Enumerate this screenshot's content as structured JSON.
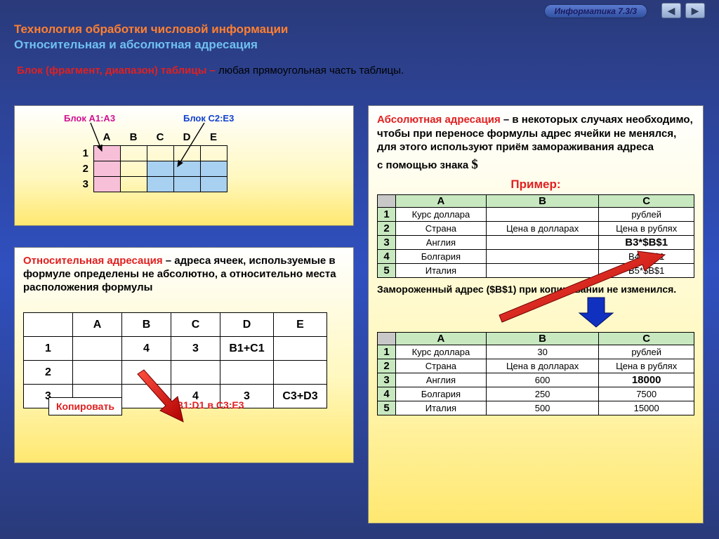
{
  "badge": "Информатика  7.3/3",
  "header": {
    "line1": "Технология обработки числовой информации",
    "line2": "Относительная и абсолютная адресация"
  },
  "definition": {
    "term": "Блок (фрагмент, диапазон) таблицы – ",
    "rest": "любая прямоугольная часть таблицы."
  },
  "topleft": {
    "label_a1": "Блок A1:A3",
    "label_c2": "Блок C2:E3",
    "cols": [
      "A",
      "B",
      "C",
      "D",
      "E"
    ],
    "rows": [
      "1",
      "2",
      "3"
    ]
  },
  "bottomleft": {
    "term": "Относительная адресация",
    "rest": " – адреса ячеек, используемые в формуле определены не абсолютно, а относительно места расположения формулы",
    "cols": [
      "A",
      "B",
      "C",
      "D",
      "E"
    ],
    "rows": [
      "1",
      "2",
      "3"
    ],
    "cells": {
      "b1": "4",
      "c1": "3",
      "d1": "B1+C1",
      "copy_label": "Копировать",
      "copy_ref": "B1:D1 в C3:E3",
      "c3": "4",
      "d3": "3",
      "e3": "C3+D3"
    }
  },
  "right": {
    "term": "Абсолютная адресация",
    "rest": " – в некоторых случаях необходимо, чтобы при переносе формулы адрес ячейки не менялся, для этого используют приём замораживания адреса",
    "dollar_prefix": "с помощью знака ",
    "dollar": "$",
    "primer": "Пример:",
    "cols": [
      "A",
      "B",
      "C"
    ],
    "rows": [
      "1",
      "2",
      "3",
      "4",
      "5"
    ],
    "table1": {
      "r1": {
        "a": "Курс доллара",
        "b": "",
        "c": "рублей"
      },
      "r2": {
        "a": "Страна",
        "b": "Цена в долларах",
        "c": "Цена в рублях"
      },
      "r3": {
        "a": "Англия",
        "b": "",
        "c": "B3*$B$1"
      },
      "r4": {
        "a": "Болгария",
        "b": "",
        "c": "B4*$B$1"
      },
      "r5": {
        "a": "Италия",
        "b": "",
        "c": "B5*$B$1"
      }
    },
    "frozen": "Замороженный адрес ($B$1) при копировании не изменился.",
    "table2": {
      "r1": {
        "a": "Курс доллара",
        "b": "30",
        "c": "рублей"
      },
      "r2": {
        "a": "Страна",
        "b": "Цена в долларах",
        "c": "Цена в рублях"
      },
      "r3": {
        "a": "Англия",
        "b": "600",
        "c": "18000"
      },
      "r4": {
        "a": "Болгария",
        "b": "250",
        "c": "7500"
      },
      "r5": {
        "a": "Италия",
        "b": "500",
        "c": "15000"
      }
    }
  }
}
